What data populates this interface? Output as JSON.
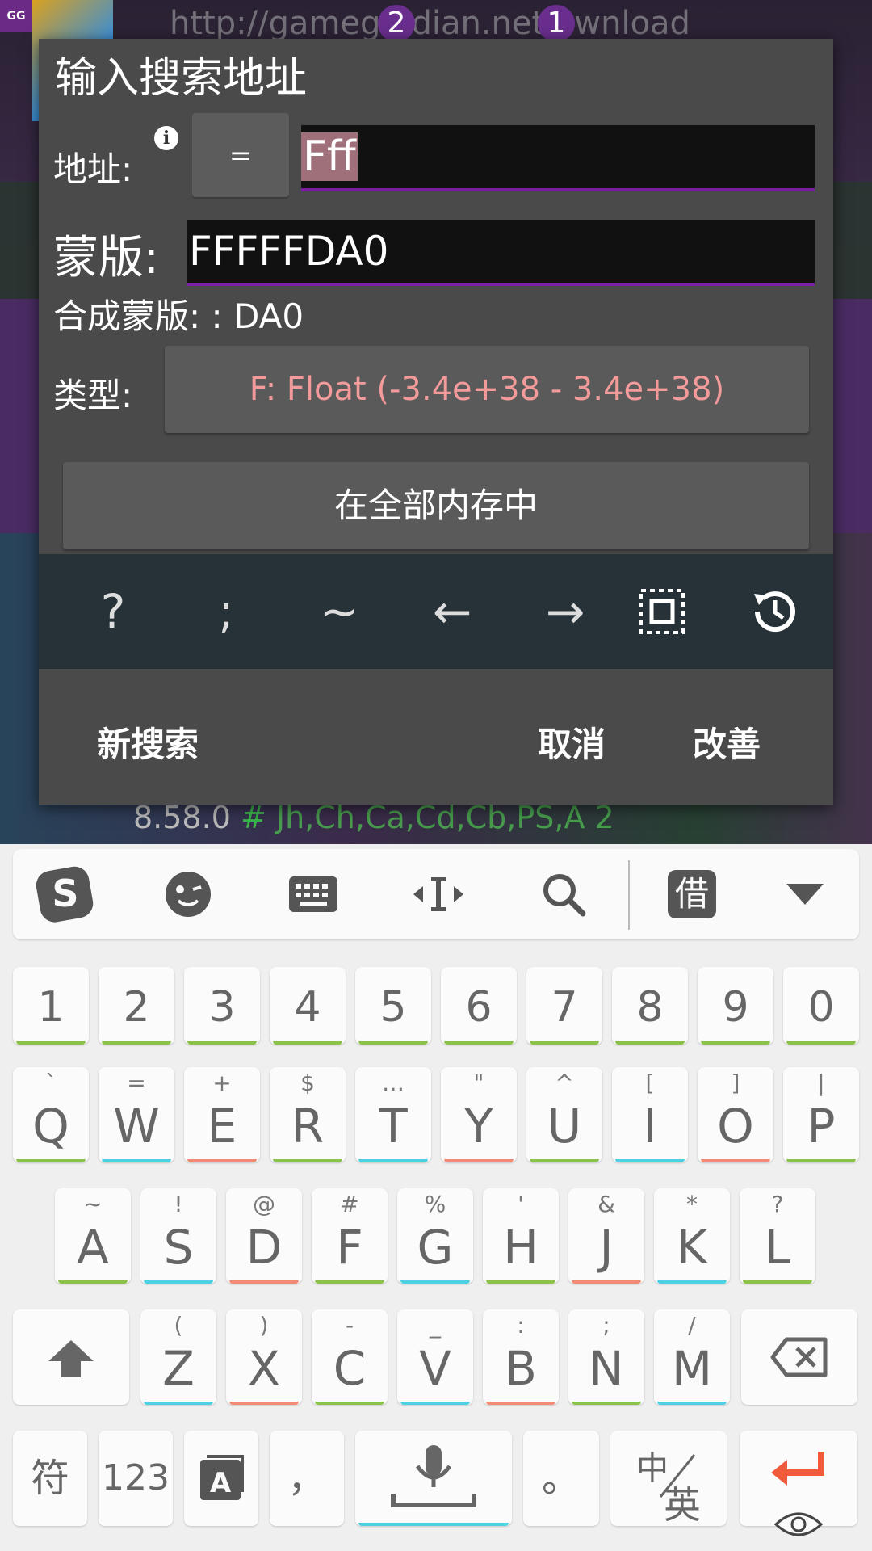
{
  "background": {
    "app_logo": "GG",
    "url_text": "http://gamegu  dian.net  ownload",
    "badges": [
      "2",
      "1"
    ],
    "version": "8.58.0",
    "hash": "#",
    "tags": "Jh,Ch,Ca,Cd,Cb,PS,A 2"
  },
  "dialog": {
    "title": "输入搜索地址",
    "address_label": "地址:",
    "info_icon": "i",
    "operator_label": "=",
    "address_value": "Fff",
    "mask_label": "蒙版:",
    "mask_value": "FFFFFDA0",
    "combined_mask_text": "合成蒙版: : DA0",
    "type_label": "类型:",
    "type_value": "F: Float (-3.4e+38 - 3.4e+38)",
    "range_value": "在全部内存中",
    "helper_keys": [
      "?",
      ";",
      "~",
      "←",
      "→",
      "select-all-icon",
      "history-icon"
    ],
    "actions": {
      "new_search": "新搜索",
      "cancel": "取消",
      "refine": "改善"
    }
  },
  "keyboard": {
    "toolbar_icons": [
      "sogou-logo-icon",
      "emoji-icon",
      "keyboard-icon",
      "cursor-icon",
      "search-icon",
      "clipboard-borrow-icon",
      "collapse-icon"
    ],
    "toolbar_borrow_label": "借",
    "number_row": [
      "1",
      "2",
      "3",
      "4",
      "5",
      "6",
      "7",
      "8",
      "9",
      "0"
    ],
    "row1": [
      {
        "main": "Q",
        "sub": "`"
      },
      {
        "main": "W",
        "sub": "="
      },
      {
        "main": "E",
        "sub": "+"
      },
      {
        "main": "R",
        "sub": "$"
      },
      {
        "main": "T",
        "sub": "…"
      },
      {
        "main": "Y",
        "sub": "\""
      },
      {
        "main": "U",
        "sub": "^"
      },
      {
        "main": "I",
        "sub": "["
      },
      {
        "main": "O",
        "sub": "]"
      },
      {
        "main": "P",
        "sub": "|"
      }
    ],
    "row2": [
      {
        "main": "A",
        "sub": "~"
      },
      {
        "main": "S",
        "sub": "!"
      },
      {
        "main": "D",
        "sub": "@"
      },
      {
        "main": "F",
        "sub": "#"
      },
      {
        "main": "G",
        "sub": "%"
      },
      {
        "main": "H",
        "sub": "'"
      },
      {
        "main": "J",
        "sub": "&"
      },
      {
        "main": "K",
        "sub": "*"
      },
      {
        "main": "L",
        "sub": "?"
      }
    ],
    "row3": [
      {
        "main": "Z",
        "sub": "("
      },
      {
        "main": "X",
        "sub": ")"
      },
      {
        "main": "C",
        "sub": "-"
      },
      {
        "main": "V",
        "sub": "_"
      },
      {
        "main": "B",
        "sub": ":"
      },
      {
        "main": "N",
        "sub": ";"
      },
      {
        "main": "M",
        "sub": "/"
      }
    ],
    "bottom_row": {
      "symbols": "符",
      "numbers": "123",
      "comma": "，",
      "period": "。",
      "lang_top": "中",
      "lang_bottom": "英"
    }
  }
}
